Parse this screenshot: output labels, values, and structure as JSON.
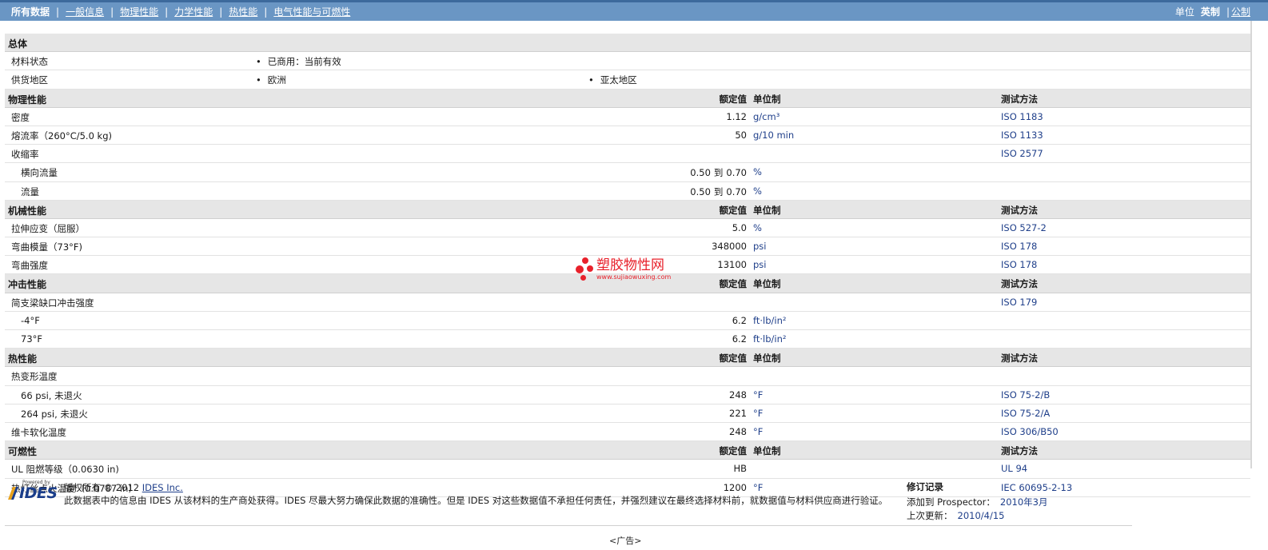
{
  "nav": {
    "tabs": [
      "所有数据",
      "一般信息",
      "物理性能",
      "力学性能",
      "热性能",
      "电气性能与可燃性"
    ],
    "units_label": "单位",
    "units_current": "英制",
    "units_alt": "公制"
  },
  "general": {
    "title": "总体",
    "rows": [
      {
        "label": "材料状态",
        "items": [
          "已商用：当前有效"
        ]
      },
      {
        "label": "供货地区",
        "items": [
          "欧洲",
          "亚太地区"
        ]
      }
    ]
  },
  "headers": {
    "nominal": "额定值",
    "unit": "单位制",
    "method": "测试方法"
  },
  "sections": [
    {
      "title": "物理性能",
      "rows": [
        {
          "label": "密度",
          "value": "1.12",
          "unit": "g/cm³",
          "method": "ISO 1183"
        },
        {
          "label": "熔流率（260°C/5.0 kg)",
          "value": "50",
          "unit": "g/10 min",
          "method": "ISO 1133"
        },
        {
          "label": "收缩率",
          "value": "",
          "unit": "",
          "method": "ISO 2577"
        },
        {
          "label": "横向流量",
          "sub": true,
          "value_from": "0.50",
          "value_to": "0.70",
          "to": "到",
          "unit": "%",
          "method": ""
        },
        {
          "label": "流量",
          "sub": true,
          "value_from": "0.50",
          "value_to": "0.70",
          "to": "到",
          "unit": "%",
          "method": ""
        }
      ]
    },
    {
      "title": "机械性能",
      "rows": [
        {
          "label": "拉伸应变（屈服）",
          "value": "5.0",
          "unit": "%",
          "method": "ISO 527-2"
        },
        {
          "label": "弯曲模量（73°F)",
          "value": "348000",
          "unit": "psi",
          "method": "ISO 178"
        },
        {
          "label": "弯曲强度",
          "value": "13100",
          "unit": "psi",
          "method": "ISO 178"
        }
      ]
    },
    {
      "title": "冲击性能",
      "rows": [
        {
          "label": "简支梁缺口冲击强度",
          "value": "",
          "unit": "",
          "method": "ISO 179"
        },
        {
          "label": "-4°F",
          "sub": true,
          "value": "6.2",
          "unit": "ft·lb/in²",
          "method": ""
        },
        {
          "label": "73°F",
          "sub": true,
          "value": "6.2",
          "unit": "ft·lb/in²",
          "method": ""
        }
      ]
    },
    {
      "title": "热性能",
      "rows": [
        {
          "label": "热变形温度",
          "value": "",
          "unit": "",
          "method": ""
        },
        {
          "label": "66 psi, 未退火",
          "sub": true,
          "value": "248",
          "unit": "°F",
          "method": "ISO 75-2/B"
        },
        {
          "label": "264 psi, 未退火",
          "sub": true,
          "value": "221",
          "unit": "°F",
          "method": "ISO 75-2/A"
        },
        {
          "label": "维卡软化温度",
          "value": "248",
          "unit": "°F",
          "method": "ISO 306/B50"
        }
      ]
    },
    {
      "title": "可燃性",
      "rows": [
        {
          "label": "UL 阻燃等级（0.0630 in)",
          "value": "HB",
          "unit": "",
          "method": "UL 94"
        },
        {
          "label": "热灯丝点火温度（0.0787 in)",
          "value": "1200",
          "unit": "°F",
          "method": "IEC 60695-2-13"
        }
      ]
    }
  ],
  "watermark": {
    "text": "塑胶物性网",
    "url": "www.sujiaowuxing.com"
  },
  "footer": {
    "logo_powered": "Powered by",
    "logo_name": "IDES",
    "copyright_prefix": "版权所有 © 2012",
    "copyright_link": "IDES Inc.",
    "disclaimer": "此数据表中的信息由  IDES 从该材料的生产商处获得。IDES 尽最大努力确保此数据的准确性。但是  IDES 对这些数据值不承担任何责任，并强烈建议在最终选择材料前，就数据值与材料供应商进行验证。",
    "revision_title": "修订记录",
    "added_label": "添加到 Prospector：",
    "added_value": "2010年3月",
    "updated_label": "上次更新：",
    "updated_value": "2010/4/15"
  },
  "ad_label": "<广告>",
  "colors": {
    "nav_bg": "#6a96c4",
    "section_bg": "#e6e6e6",
    "link_blue": "#1f3f8a",
    "watermark_red": "#e8212b"
  }
}
